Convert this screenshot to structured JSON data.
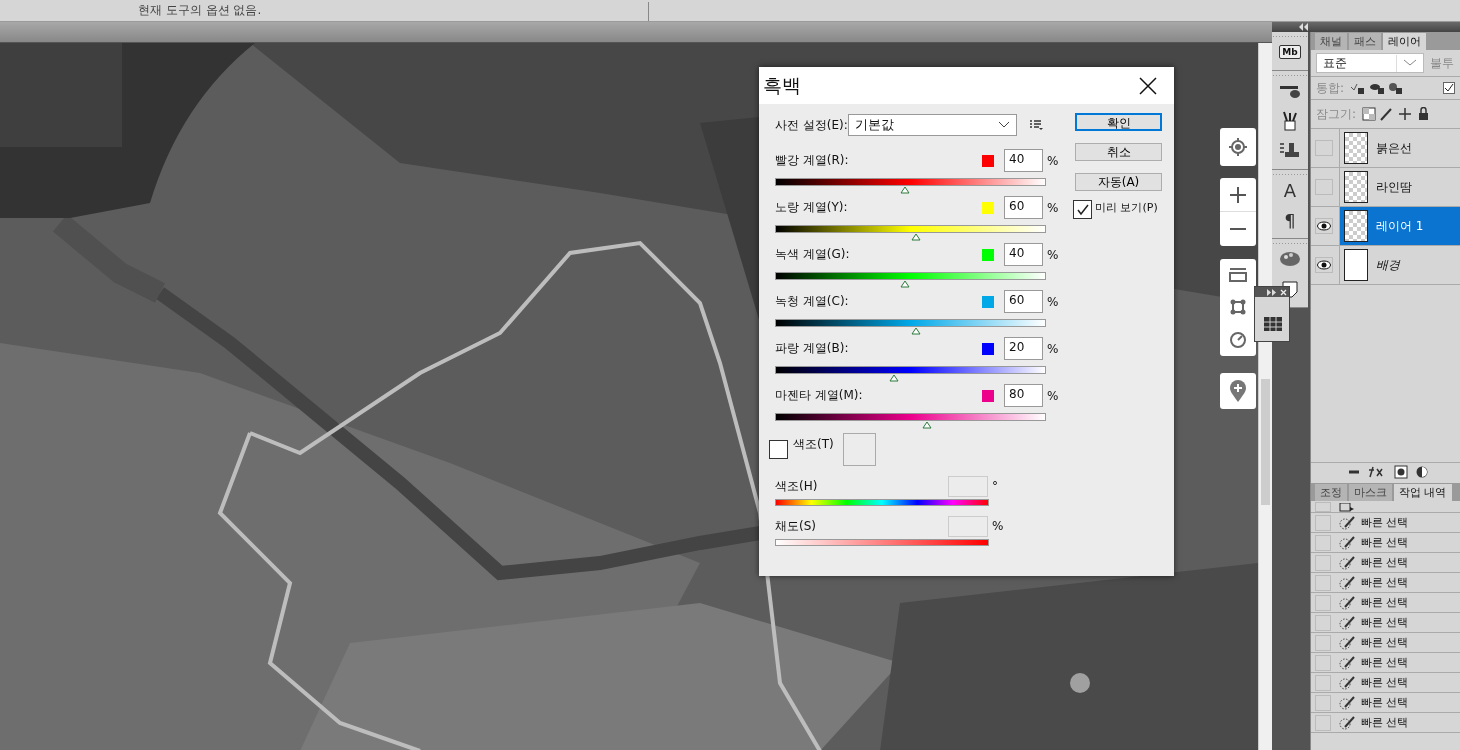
{
  "options_bar": {
    "text": "현재 도구의 옵션 없음."
  },
  "dialog": {
    "title": "흑백",
    "preset_label": "사전 설정(E):",
    "preset_value": "기본값",
    "channels": [
      {
        "name": "빨강 계열(R):",
        "color": "#ff0000",
        "value": "40",
        "unit": "%",
        "level": 0.48
      },
      {
        "name": "노랑 계열(Y):",
        "color": "#ffff00",
        "value": "60",
        "unit": "%",
        "level": 0.52
      },
      {
        "name": "녹색 계열(G):",
        "color": "#00ff00",
        "value": "40",
        "unit": "%",
        "level": 0.48
      },
      {
        "name": "녹청 계열(C):",
        "color": "#00a8e8",
        "value": "60",
        "unit": "%",
        "level": 0.52
      },
      {
        "name": "파랑 계열(B):",
        "color": "#0000ff",
        "value": "20",
        "unit": "%",
        "level": 0.44
      },
      {
        "name": "마젠타 계열(M):",
        "color": "#ec008c",
        "value": "80",
        "unit": "%",
        "level": 0.56
      }
    ],
    "buttons": [
      {
        "label": "확인",
        "default": true
      },
      {
        "label": "취소",
        "default": false
      },
      {
        "label": "자동(A)",
        "default": false
      }
    ],
    "preview": {
      "label": "미리 보기(P)",
      "checked": true
    },
    "tint": {
      "label": "색조(T)",
      "checked": false
    },
    "hue": {
      "label": "색조(H)",
      "unit": "°"
    },
    "saturation": {
      "label": "채도(S)",
      "unit": "%"
    }
  },
  "tools": [
    {
      "kind": "badge",
      "glyph": "Mb"
    },
    {
      "kind": "brush"
    },
    {
      "kind": "brushes"
    },
    {
      "kind": "stamp"
    },
    {
      "kind": "glyph",
      "glyph": "A"
    },
    {
      "kind": "glyph",
      "glyph": "¶"
    },
    {
      "kind": "palette"
    },
    {
      "kind": "note"
    }
  ],
  "layers_panel": {
    "tabs": [
      {
        "label": "채널",
        "selected": false
      },
      {
        "label": "패스",
        "selected": false
      },
      {
        "label": "레이어",
        "selected": true
      }
    ],
    "blend_mode": "표준",
    "opacity_label": "불투",
    "merge_label": "통합:",
    "merge_checked": true,
    "lock_label": "잠그기:",
    "layers": [
      {
        "name": "붉은선",
        "kind": "transparent",
        "visible": false,
        "selected": false
      },
      {
        "name": "라인땀",
        "kind": "transparent",
        "visible": false,
        "selected": false
      },
      {
        "name": "레이어 1",
        "kind": "transparent",
        "visible": true,
        "selected": true
      },
      {
        "name": "배경",
        "kind": "background",
        "visible": true,
        "selected": false
      }
    ]
  },
  "history_panel": {
    "tabs": [
      {
        "label": "조정",
        "selected": false
      },
      {
        "label": "마스크",
        "selected": false
      },
      {
        "label": "작업 내역",
        "selected": true
      }
    ],
    "items": [
      {
        "kind": "step"
      },
      {
        "kind": "quick_select",
        "label": "빠른 선택"
      },
      {
        "kind": "quick_select",
        "label": "빠른 선택"
      },
      {
        "kind": "quick_select",
        "label": "빠른 선택"
      },
      {
        "kind": "quick_select",
        "label": "빠른 선택"
      },
      {
        "kind": "quick_select",
        "label": "빠른 선택"
      },
      {
        "kind": "quick_select",
        "label": "빠른 선택"
      },
      {
        "kind": "quick_select",
        "label": "빠른 선택"
      },
      {
        "kind": "quick_select",
        "label": "빠른 선택"
      },
      {
        "kind": "quick_select",
        "label": "빠른 선택"
      },
      {
        "kind": "quick_select",
        "label": "빠른 선택"
      },
      {
        "kind": "quick_select",
        "label": "빠른 선택"
      }
    ]
  }
}
